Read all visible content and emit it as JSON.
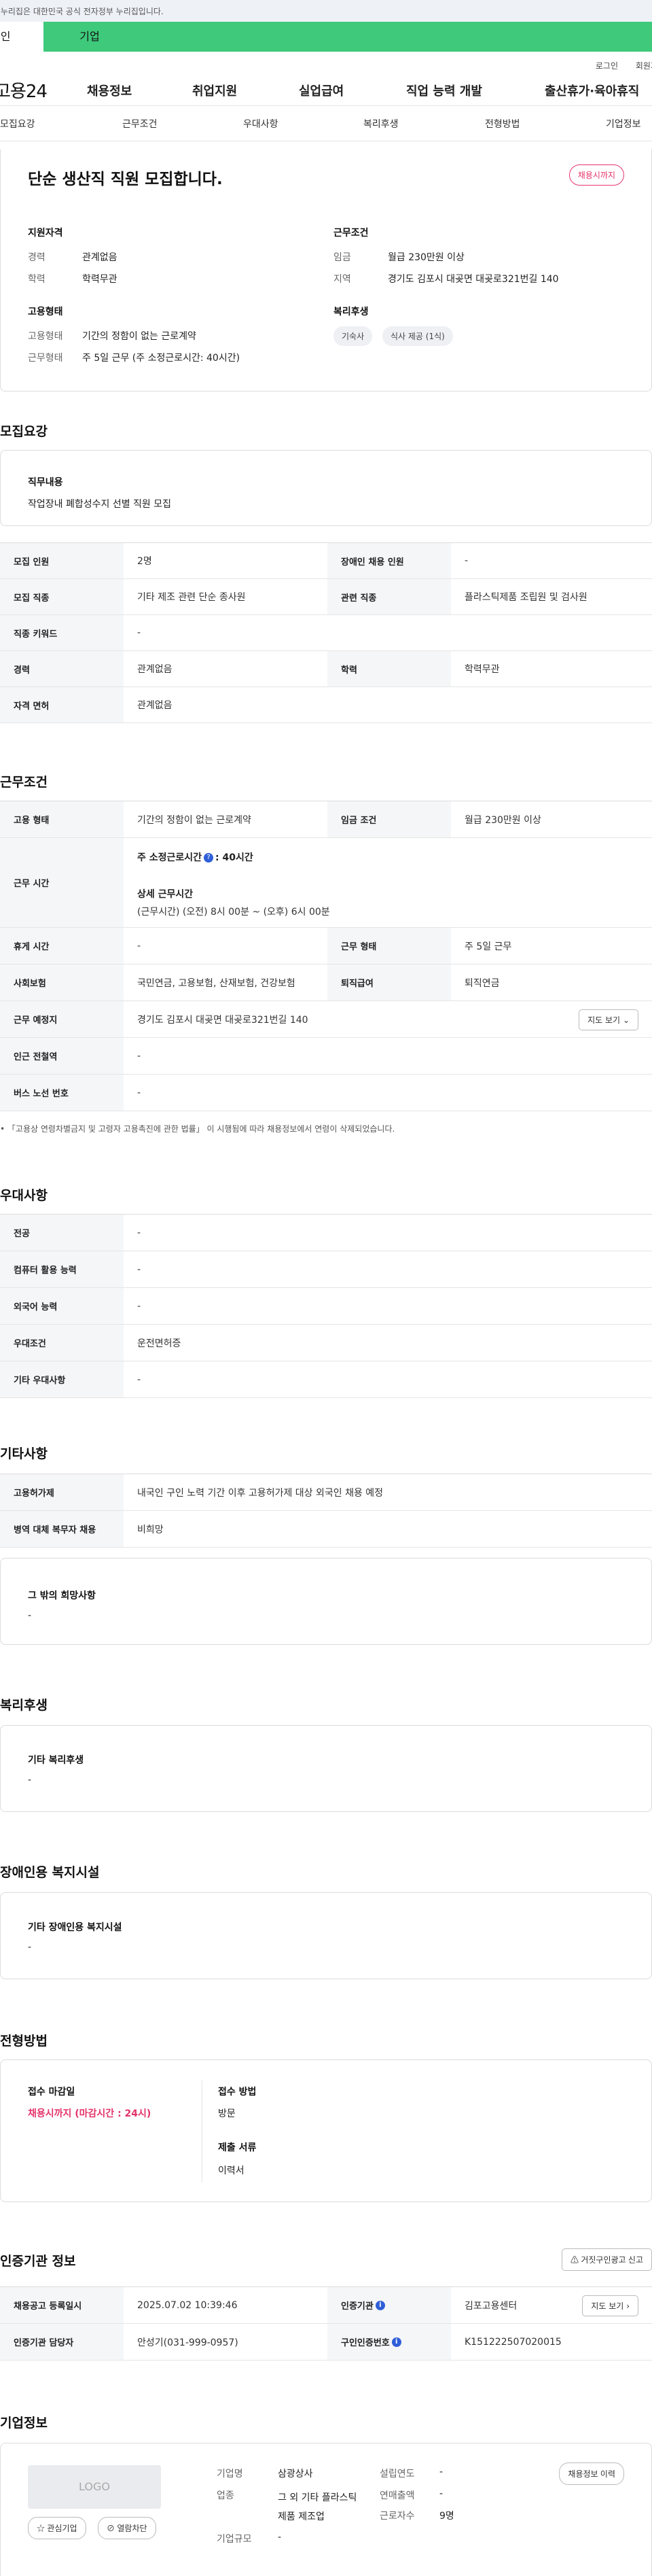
{
  "gov_banner": "이 누리집은 대한민국 공식 전자정부 누리집입니다.",
  "tabs": {
    "personal": "개인",
    "business": "기업"
  },
  "util": {
    "login": "로그인",
    "join": "회원가입"
  },
  "brand": "고용24",
  "gnb": [
    "채용정보",
    "취업지원",
    "실업급여",
    "직업 능력 개발",
    "출산휴가·육아휴직"
  ],
  "subnav": [
    "모집요강",
    "근무조건",
    "우대사항",
    "복리후생",
    "전형방법",
    "기업정보"
  ],
  "summary": {
    "title": "단순 생산직 직원 모집합니다.",
    "badge": "채용시까지",
    "qual": {
      "title": "지원자격",
      "career_label": "경력",
      "career": "관계없음",
      "edu_label": "학력",
      "edu": "학력무관"
    },
    "cond": {
      "title": "근무조건",
      "wage_label": "임금",
      "wage": "월급 230만원 이상",
      "area_label": "지역",
      "area": "경기도 김포시 대곶면 대곶로321번길 140"
    },
    "emp": {
      "title": "고용형태",
      "type_label": "고용형태",
      "type": "기간의 정함이 없는 근로계약",
      "time_label": "근무형태",
      "time": "주 5일 근무 (주 소정근로시간: 40시간)"
    },
    "welfare": {
      "title": "복리후생",
      "pills": [
        "기숙사",
        "식사 제공 (1식)"
      ]
    }
  },
  "recruit": {
    "title": "모집요강",
    "duty_label": "직무내용",
    "duty": "작업장내 폐합성수지 선별 직원 모집",
    "rows": [
      {
        "h1": "모집 인원",
        "v1": "2명",
        "h2": "장애인 채용 인원",
        "v2": "-"
      },
      {
        "h1": "모집 직종",
        "v1": "기타 제조 관련 단순 종사원",
        "h2": "관련 직종",
        "v2": "플라스틱제품 조립원 및 검사원"
      },
      {
        "h1": "직종 키워드",
        "v1": "-"
      },
      {
        "h1": "경력",
        "v1": "관계없음",
        "h2": "학력",
        "v2": "학력무관"
      },
      {
        "h1": "자격 면허",
        "v1": "관계없음"
      }
    ]
  },
  "work": {
    "title": "근무조건",
    "emp_type_h": "고용 형태",
    "emp_type": "기간의 정함이 없는 근로계약",
    "wage_h": "임금 조건",
    "wage": "월급 230만원 이상",
    "hours_h": "근무 시간",
    "hours_line1_a": "주 소정근로시간",
    "hours_line1_b": ": 40시간",
    "hours_detail_title": "상세 근무시간",
    "hours_detail": "(근무시간) (오전) 8시 00분 ~ (오후) 6시 00분",
    "break_h": "휴게 시간",
    "break": "-",
    "shift_h": "근무 형태",
    "shift": "주 5일 근무",
    "ins_h": "사회보험",
    "ins": "국민연금, 고용보험, 산재보험, 건강보험",
    "sev_h": "퇴직급여",
    "sev": "퇴직연금",
    "place_h": "근무 예정지",
    "place": "경기도 김포시 대곶면 대곶로321번길 140",
    "map_btn": "지도 보기",
    "subway_h": "인근 전철역",
    "subway": "-",
    "bus_h": "버스 노선 번호",
    "bus": "-",
    "note": "「고용상 연령차별금지 및 고령자 고용촉진에 관한 법률」 이 시행됨에 따라 채용정보에서 연령이 삭제되었습니다."
  },
  "pref": {
    "title": "우대사항",
    "rows": [
      {
        "h": "전공",
        "v": "-"
      },
      {
        "h": "컴퓨터 활용 능력",
        "v": "-"
      },
      {
        "h": "외국어 능력",
        "v": "-"
      },
      {
        "h": "우대조건",
        "v": "운전면허증"
      },
      {
        "h": "기타 우대사항",
        "v": "-"
      }
    ]
  },
  "etc": {
    "title": "기타사항",
    "rows": [
      {
        "h": "고용허가제",
        "v": "내국인 구인 노력 기간 이후 고용허가제 대상 외국인 채용 예정"
      },
      {
        "h": "병역 대체 복무자 채용",
        "v": "비희망"
      }
    ],
    "other_title": "그 밖의 희망사항",
    "other": "-"
  },
  "welfare": {
    "title": "복리후생",
    "sub": "기타 복리후생",
    "val": "-"
  },
  "disabled": {
    "title": "장애인용 복지시설",
    "sub": "기타 장애인용 복지시설",
    "val": "-"
  },
  "process": {
    "title": "전형방법",
    "deadline_label": "접수 마감일",
    "deadline": "채용시까지 (마감시간 : 24시)",
    "method_label": "접수 방법",
    "method": "방문",
    "docs_label": "제출 서류",
    "docs": "이력서"
  },
  "agency": {
    "title": "인증기관 정보",
    "report_btn": "거짓구인광고 신고",
    "reg_h": "채용공고 등록일시",
    "reg": "2025.07.02 10:39:46",
    "org_h": "인증기관",
    "org": "김포고용센터",
    "map_btn": "지도 보기",
    "staff_h": "인증기관 담당자",
    "staff": "안성기(031-999-0957)",
    "no_h": "구인인증번호",
    "no": "K151222507020015"
  },
  "company": {
    "title": "기업정보",
    "logo": "LOGO",
    "fav_btn": "관심기업",
    "block_btn": "열람차단",
    "hist_btn": "채용정보 이력",
    "name_l": "기업명",
    "name": "삼광상사",
    "year_l": "설립연도",
    "year": "-",
    "ind_l": "업종",
    "ind": "그 외 기타 플라스틱 제품 제조업",
    "sales_l": "연매출액",
    "sales": "-",
    "emp_l": "근로자수",
    "emp": "9명",
    "size_l": "기업규모",
    "size": "-"
  }
}
